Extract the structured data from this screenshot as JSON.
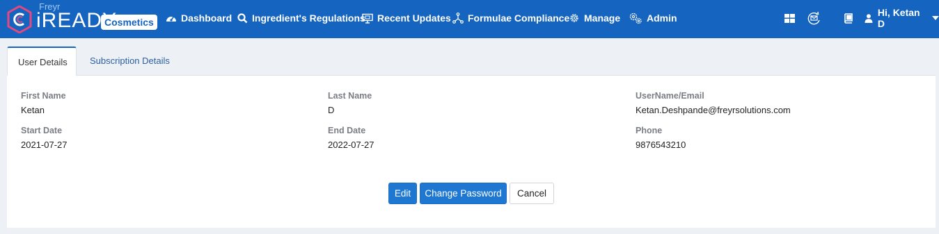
{
  "brand": {
    "company": "Freyr",
    "product": "iREADY",
    "module_badge": "Cosmetics"
  },
  "nav": {
    "items": [
      {
        "label": "Dashboard",
        "icon": "dashboard-gauge-icon"
      },
      {
        "label": "Ingredient's Regulations",
        "icon": "search-icon"
      },
      {
        "label": "Recent Updates",
        "icon": "presentation-board-icon"
      },
      {
        "label": "Formulae Compliance",
        "icon": "molecule-network-icon"
      },
      {
        "label": "Manage",
        "icon": "gear-icon"
      },
      {
        "label": "Admin",
        "icon": "gears-icon"
      }
    ]
  },
  "header_icons": [
    "grid-apps-icon",
    "email-refresh-icon",
    "book-icon"
  ],
  "user": {
    "greeting": "Hi, Ketan D"
  },
  "tabs": [
    {
      "label": "User Details",
      "active": true
    },
    {
      "label": "Subscription Details",
      "active": false
    }
  ],
  "details": {
    "first_name": {
      "label": "First Name",
      "value": "Ketan"
    },
    "last_name": {
      "label": "Last Name",
      "value": "D"
    },
    "username": {
      "label": "UserName/Email",
      "value": "Ketan.Deshpande@freyrsolutions.com"
    },
    "start_date": {
      "label": "Start Date",
      "value": "2021-07-27"
    },
    "end_date": {
      "label": "End Date",
      "value": "2022-07-27"
    },
    "phone": {
      "label": "Phone",
      "value": "9876543210"
    }
  },
  "actions": {
    "edit": "Edit",
    "change_password": "Change Password",
    "cancel": "Cancel"
  },
  "colors": {
    "header_bg": "#1565c0",
    "primary_button": "#1e78d2",
    "page_bg": "#edf0f4"
  }
}
